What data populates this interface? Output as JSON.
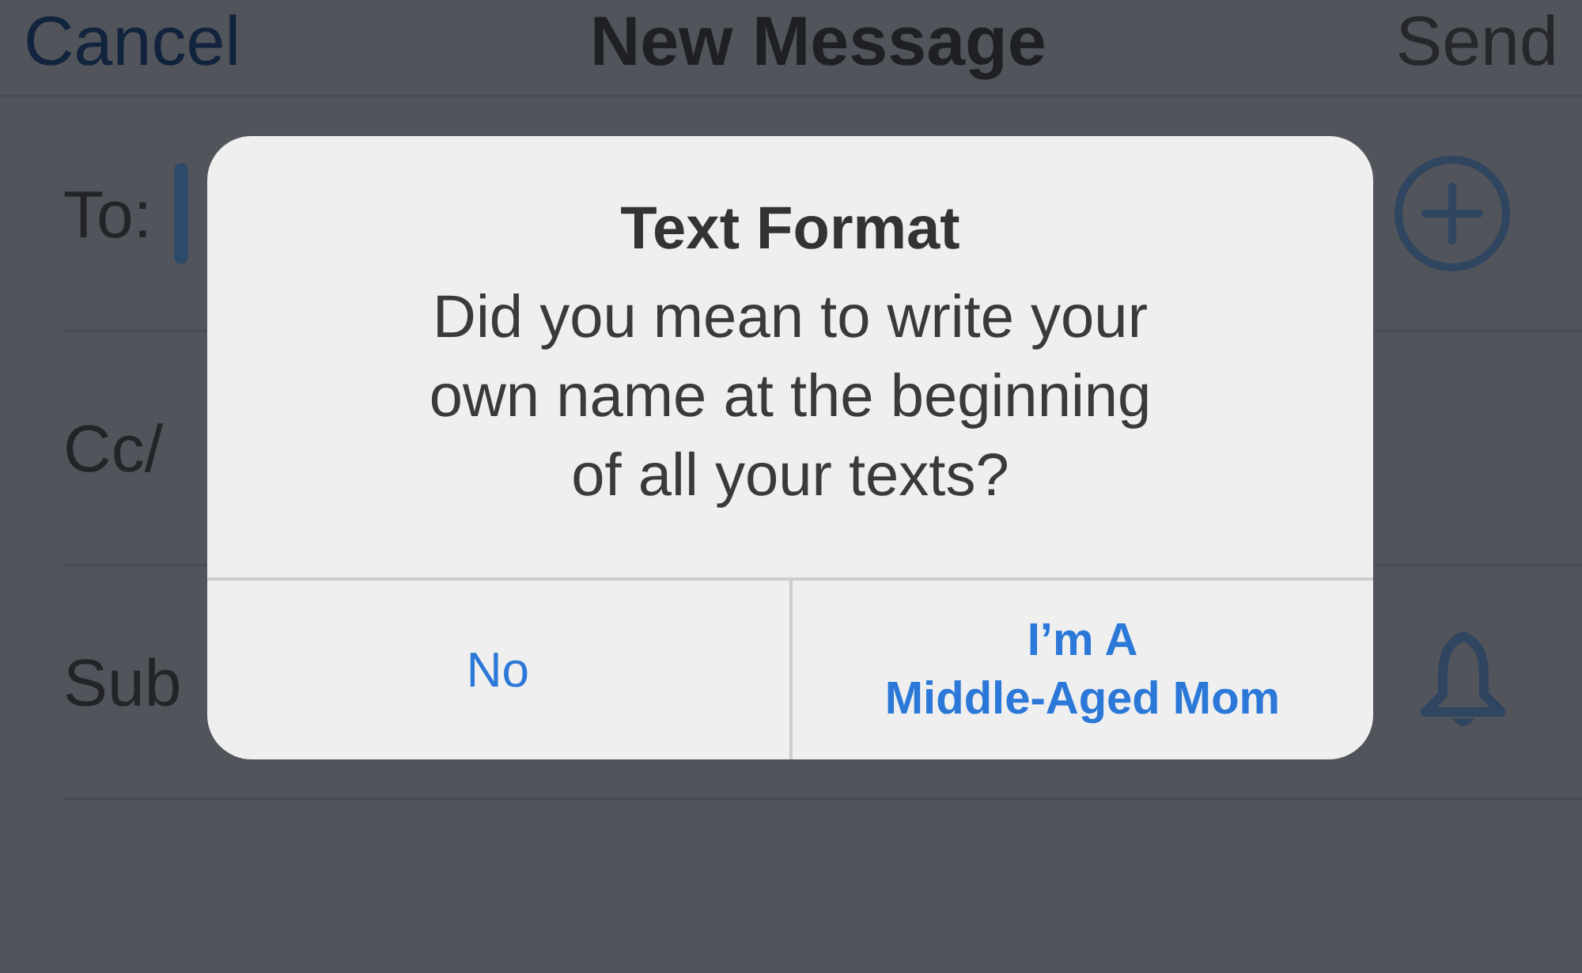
{
  "nav_bar": {
    "cancel": "Cancel",
    "title": "New Message",
    "send": {
      "label": "Send",
      "disabled": true
    }
  },
  "fields": [
    {
      "label": "To:",
      "kind": "to",
      "focused": true
    },
    {
      "label": "Cc/",
      "kind": "plain",
      "focused": false
    },
    {
      "label": "Sub",
      "kind": "subject",
      "focused": false
    }
  ],
  "alert": {
    "title": "Text Format",
    "message": "Did you mean to write your own name at the beginning of all your texts?",
    "buttons": [
      {
        "label": "No",
        "kind": "normal"
      },
      {
        "label": "I’m A\nMiddle-Aged Mom",
        "kind": "preferred"
      }
    ]
  }
}
